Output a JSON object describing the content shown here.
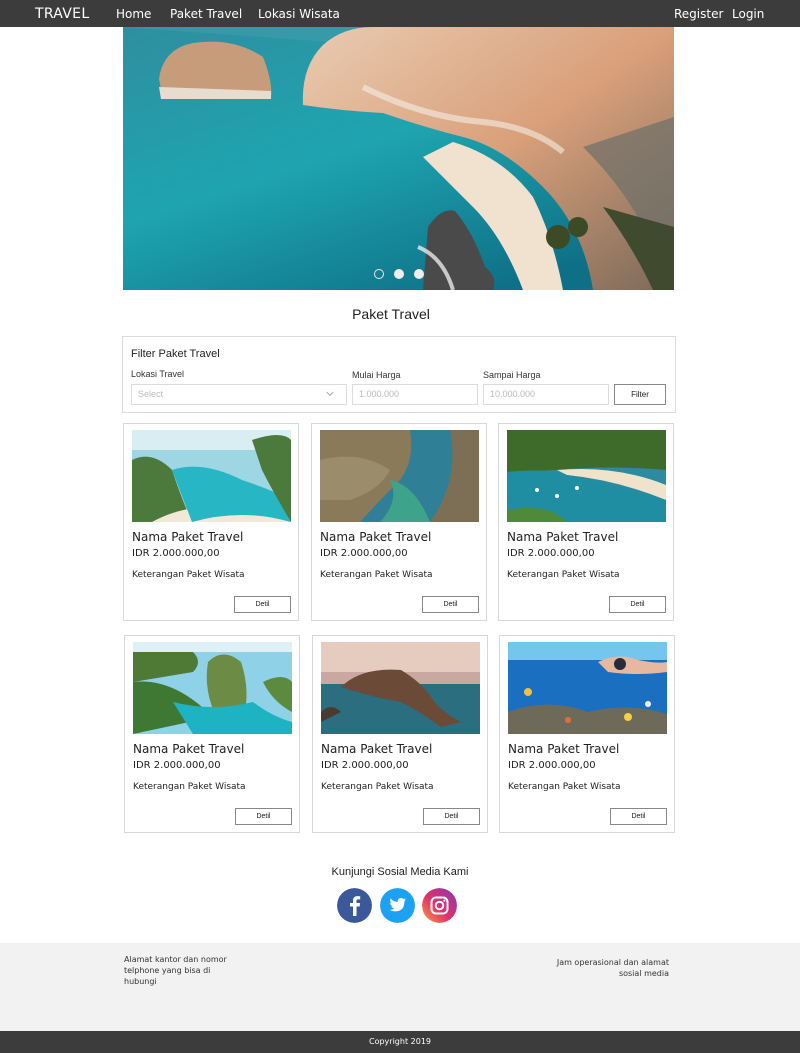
{
  "navbar": {
    "brand": "TRAVEL",
    "links": [
      "Home",
      "Paket Travel",
      "Lokasi Wisata"
    ],
    "register": "Register",
    "login": "Login"
  },
  "hero": {
    "slides_total": 3,
    "active_slide": 2
  },
  "section_title": "Paket Travel",
  "filter": {
    "title": "Filter Paket Travel",
    "location_label": "Lokasi Travel",
    "location_placeholder": "Select",
    "min_label": "Mulai Harga",
    "min_placeholder": "1.000.000",
    "max_label": "Sampai Harga",
    "max_placeholder": "10.000.000",
    "button": "Filter"
  },
  "cards": [
    {
      "title": "Nama Paket Travel",
      "price": "IDR 2.000.000,00",
      "desc": "Keterangan Paket Wisata",
      "button": "Detil",
      "image": "beach-cliff"
    },
    {
      "title": "Nama Paket Travel",
      "price": "IDR 2.000.000,00",
      "desc": "Keterangan Paket Wisata",
      "button": "Detil",
      "image": "rock-pool"
    },
    {
      "title": "Nama Paket Travel",
      "price": "IDR 2.000.000,00",
      "desc": "Keterangan Paket Wisata",
      "button": "Detil",
      "image": "bay-boats"
    },
    {
      "title": "Nama Paket Travel",
      "price": "IDR 2.000.000,00",
      "desc": "Keterangan Paket Wisata",
      "button": "Detil",
      "image": "island-bay"
    },
    {
      "title": "Nama Paket Travel",
      "price": "IDR 2.000.000,00",
      "desc": "Keterangan Paket Wisata",
      "button": "Detil",
      "image": "sunset-coast"
    },
    {
      "title": "Nama Paket Travel",
      "price": "IDR 2.000.000,00",
      "desc": "Keterangan Paket Wisata",
      "button": "Detil",
      "image": "snorkeling"
    }
  ],
  "social": {
    "title": "Kunjungi Sosial Media Kami",
    "icons": [
      "facebook-icon",
      "twitter-icon",
      "instagram-icon"
    ],
    "colors": {
      "facebook": "#3b5998",
      "twitter": "#1da1f2",
      "instagram": "#c13584"
    }
  },
  "footer": {
    "left": "Alamat kantor dan nomor telphone yang bisa di hubungi",
    "right": "Jam operasional dan alamat sosial media",
    "copyright": "Copyright 2019"
  },
  "colors": {
    "navbar": "#3c3c3c",
    "footer_bg": "#f2f2f2",
    "border": "#d8d8d8"
  }
}
